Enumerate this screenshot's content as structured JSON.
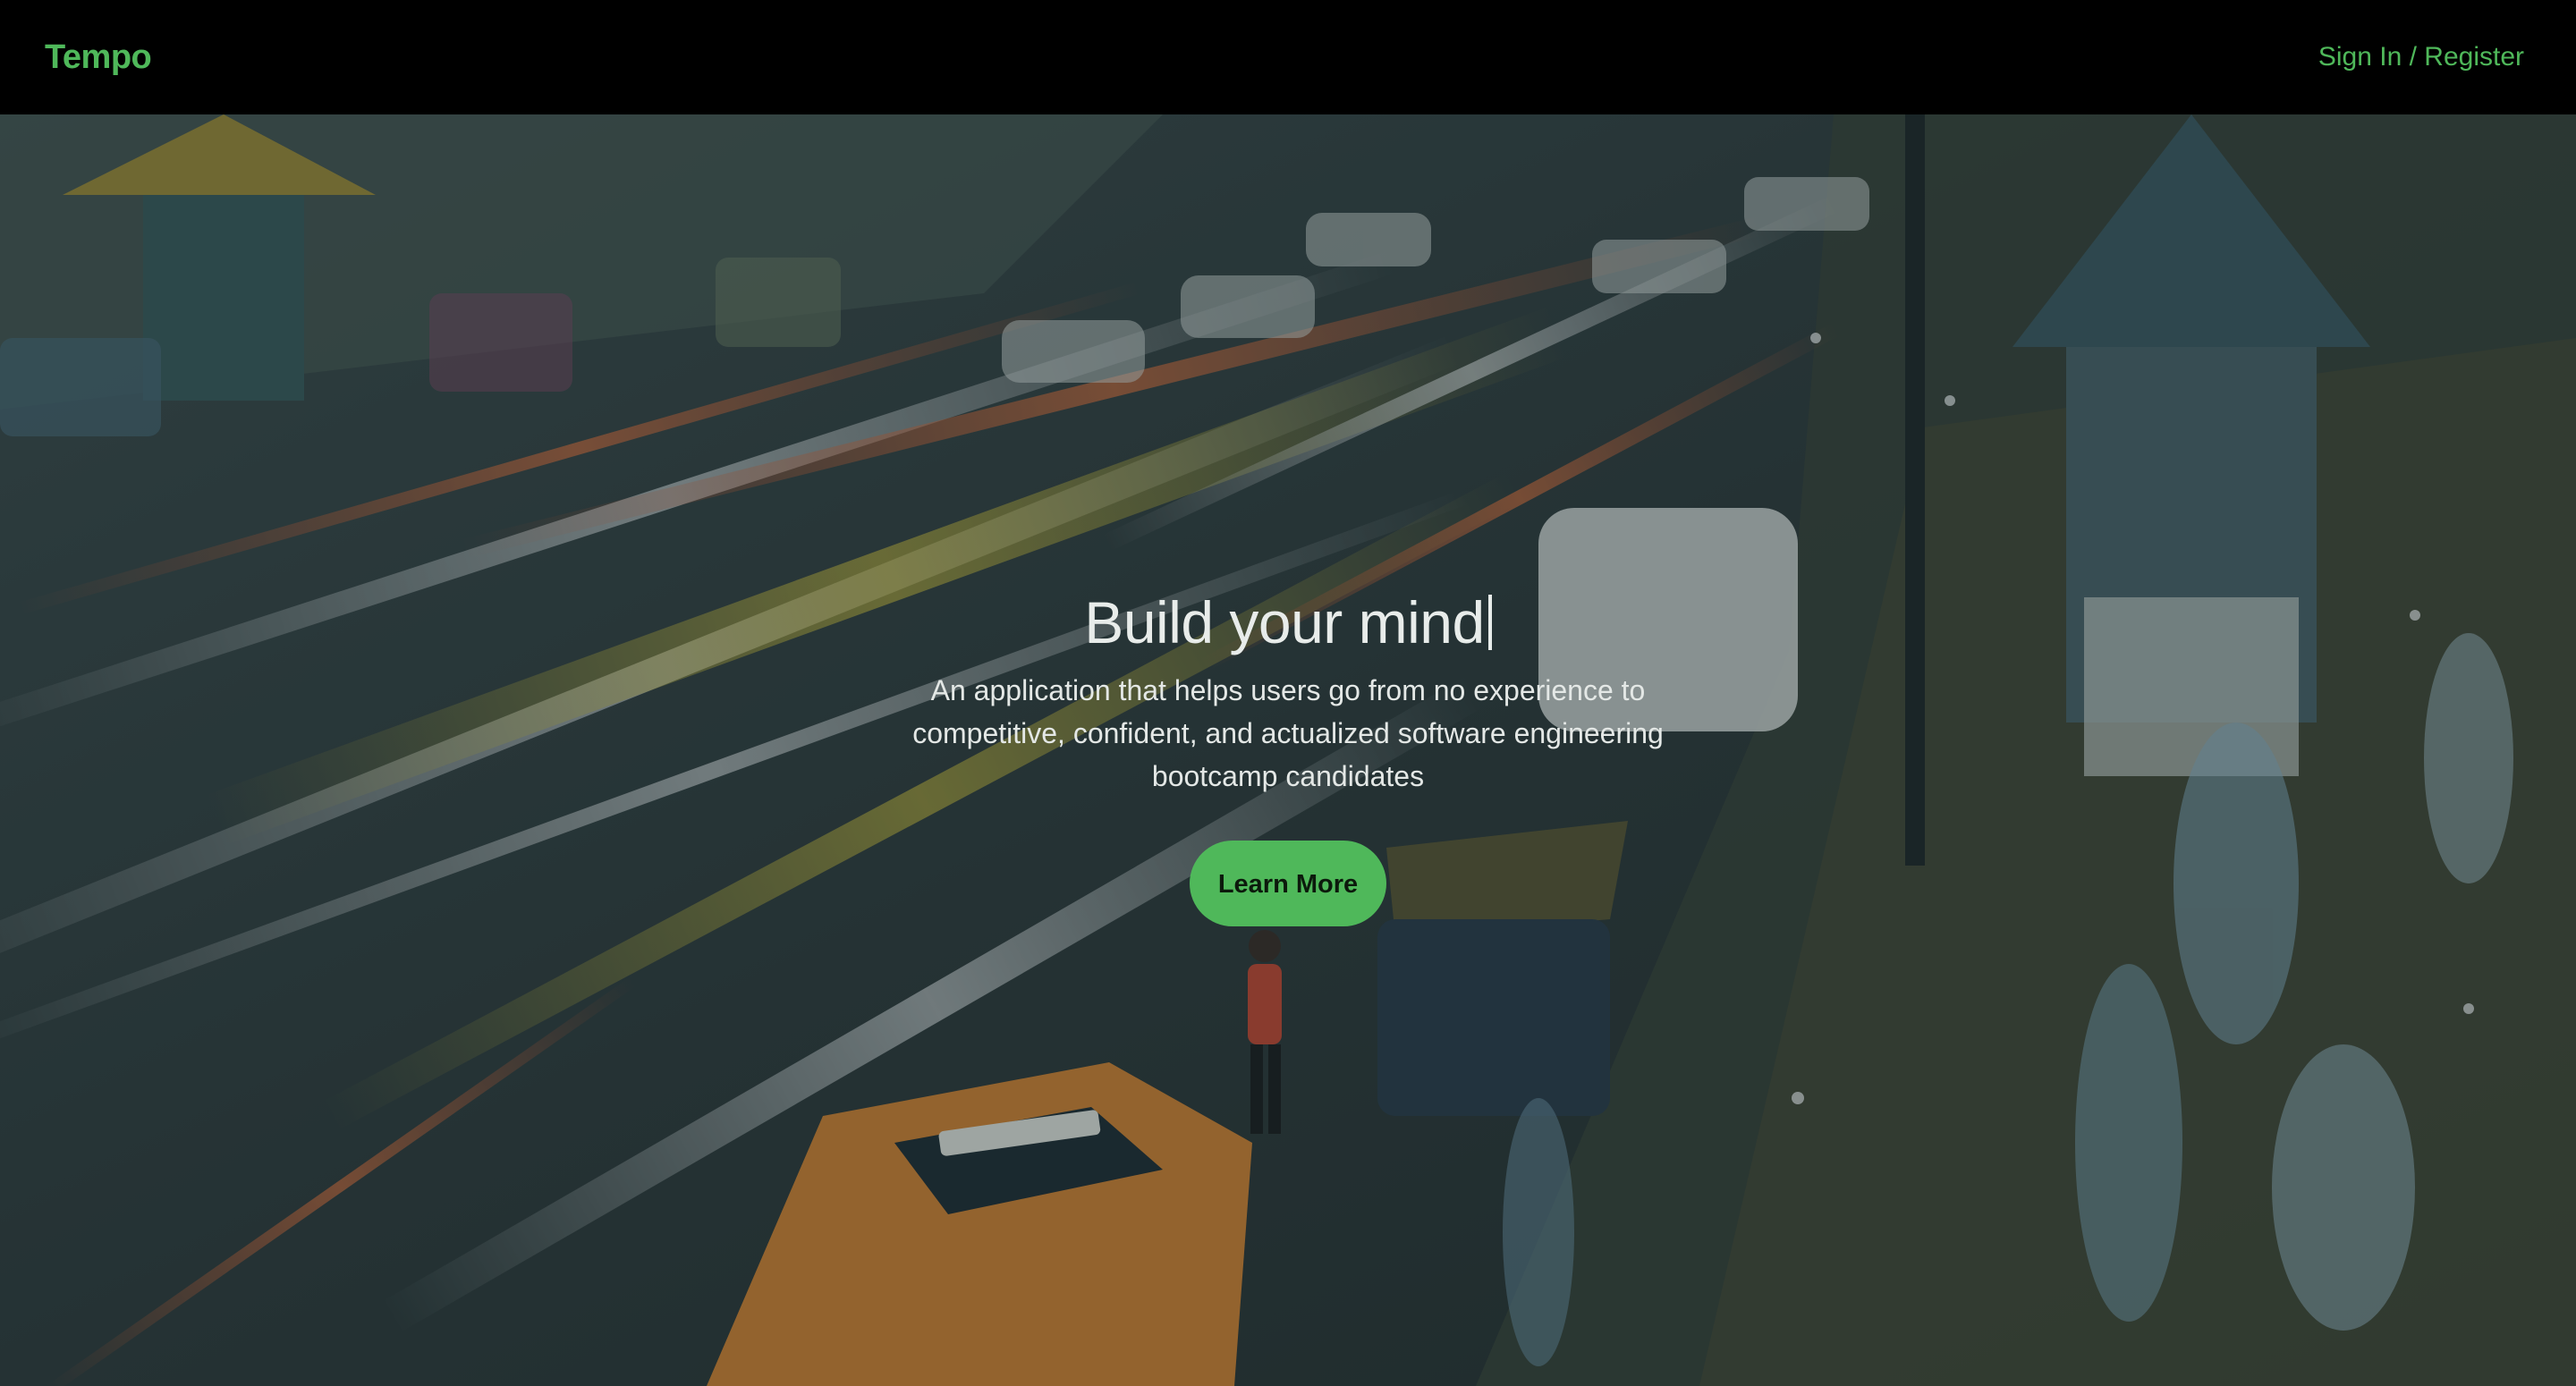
{
  "nav": {
    "brand": "Tempo",
    "auth_link": "Sign In / Register",
    "brand_color": "#4fb85a"
  },
  "hero": {
    "title": "Build your mind",
    "subtitle": "An application that helps users go from no experience to competitive, confident, and actualized software engineering bootcamp candidates",
    "cta_label": "Learn More",
    "cta_color": "#4fb85a",
    "background": "night-city-street-traffic-photo"
  }
}
